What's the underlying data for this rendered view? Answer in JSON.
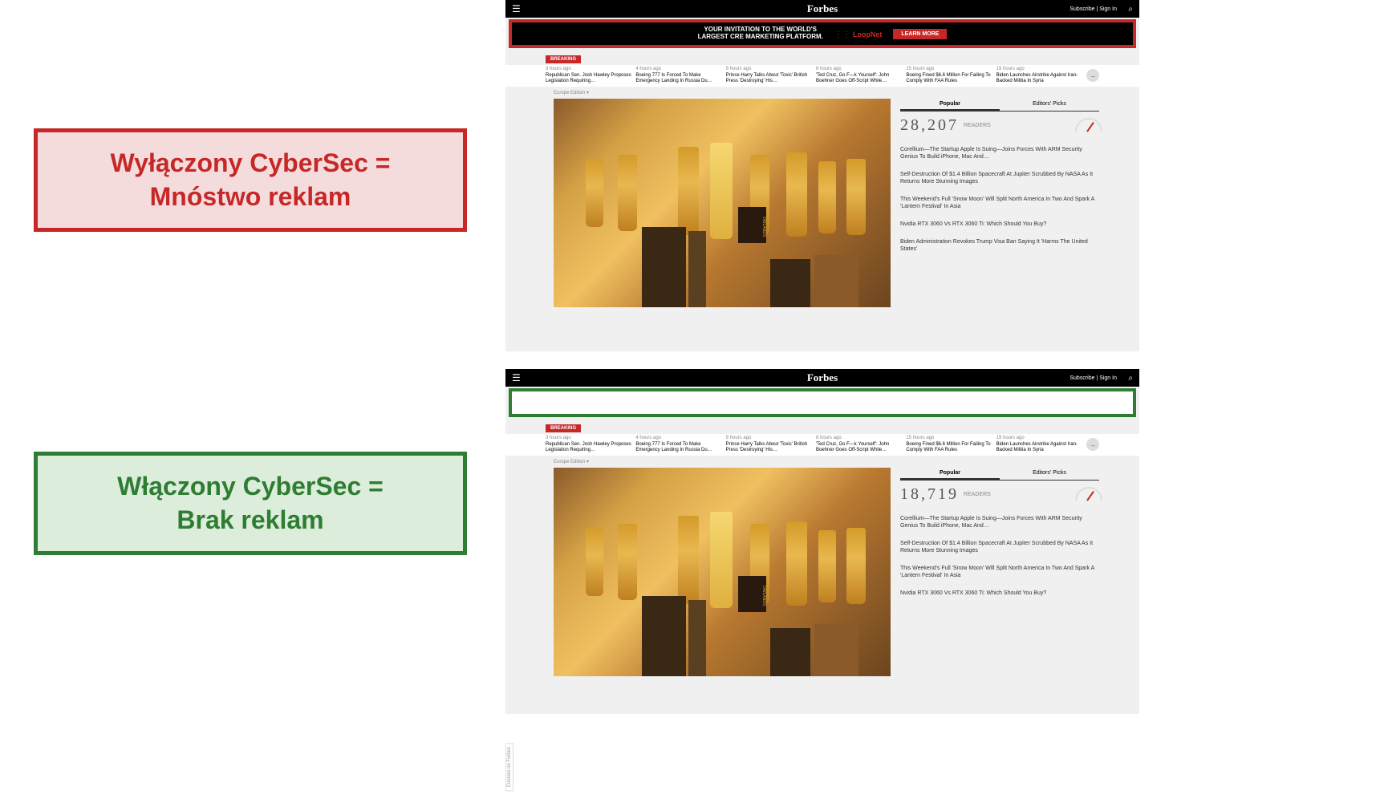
{
  "labels": {
    "red_line1": "Wyłączony CyberSec =",
    "red_line2": "Mnóstwo reklam",
    "green_line1": "Włączony CyberSec =",
    "green_line2": "Brak reklam"
  },
  "forbes": {
    "logo": "Forbes",
    "subscribe": "Subscribe | Sign In",
    "breaking": "BREAKING",
    "edition": "Europe Edition ▾"
  },
  "ad": {
    "line1": "YOUR INVITATION TO THE WORLD'S",
    "line2": "LARGEST CRE MARKETING PLATFORM.",
    "brand": "LoopNet",
    "cta": "LEARN MORE"
  },
  "news": [
    {
      "time": "3 hours ago",
      "title": "Republican Sen. Josh Hawley Proposes Legislation Requiring…"
    },
    {
      "time": "4 hours ago",
      "title": "Boeing 777 Is Forced To Make Emergency Landing In Russia Du…"
    },
    {
      "time": "9 hours ago",
      "title": "Prince Harry Talks About 'Toxic' British Press 'Destroying' His…"
    },
    {
      "time": "8 hours ago",
      "title": "'Ted Cruz, Go F—k Yourself': John Boehner Goes Off-Script While…"
    },
    {
      "time": "15 hours ago",
      "title": "Boeing Fined $6.6 Million For Failing To Comply With FAA Rules"
    },
    {
      "time": "19 hours ago",
      "title": "Biden Launches Airstrike Against Iran-Backed Militia In Syria"
    }
  ],
  "popular": {
    "tab_popular": "Popular",
    "tab_editors": "Editors' Picks",
    "readers_top": "28,207",
    "readers_bot": "18,719",
    "readers_label": "READERS",
    "items": [
      "Corellium—The Startup Apple Is Suing—Joins Forces With ARM Security Genius To Build iPhone, Mac And…",
      "Self-Destruction Of $1.4 Billion Spacecraft At Jupiter Scrubbed By NASA As It Returns More Stunning Images",
      "This Weekend's Full 'Snow Moon' Will Split North America In Two And Spark A 'Lantern Festival' In Asia",
      "Nvidia RTX 3060 Vs RTX 3060 Ti: Which Should You Buy?",
      "Biden Administration Revokes Trump Visa Ban Saying It 'Harms The United States'"
    ]
  },
  "cookies": "Cookies on Forbes",
  "owlands": "OWLANDS"
}
